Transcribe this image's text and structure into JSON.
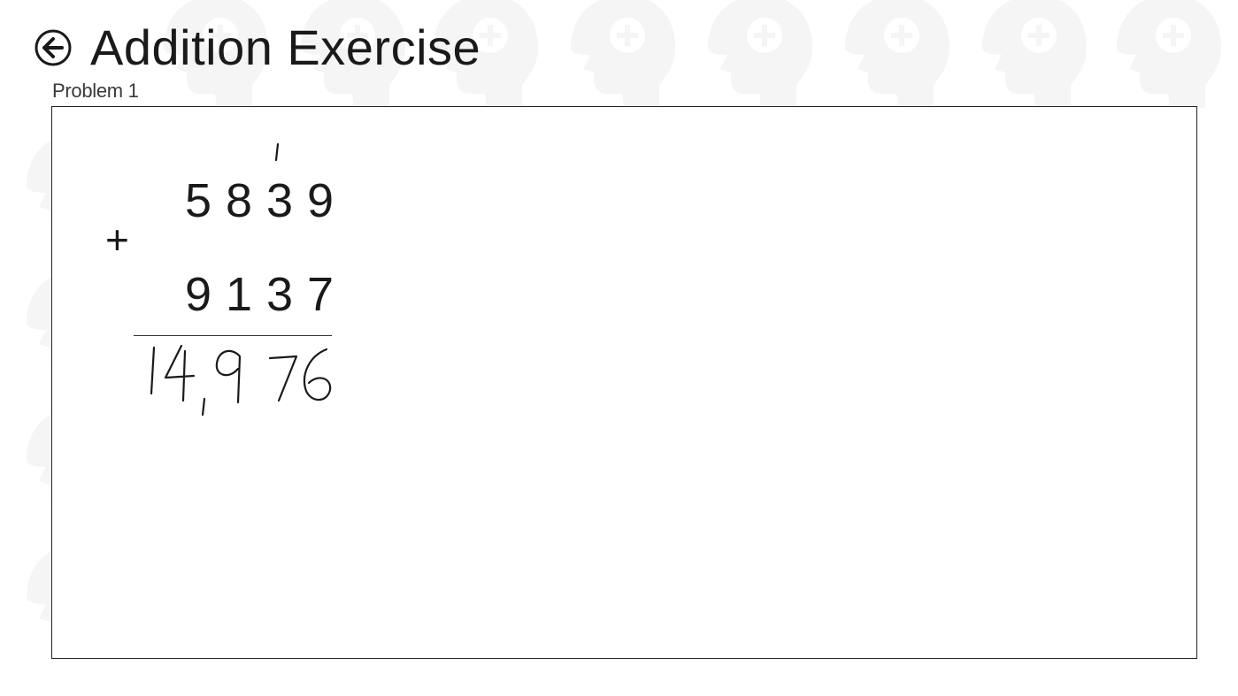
{
  "header": {
    "title": "Addition Exercise",
    "back_icon": "back-arrow-circle-icon"
  },
  "problem": {
    "label": "Problem 1",
    "addend_top": [
      "5",
      "8",
      "3",
      "9"
    ],
    "operator": "+",
    "addend_bottom": [
      "9",
      "1",
      "3",
      "7"
    ],
    "handwritten_carry": "1",
    "handwritten_answer": "14,976"
  },
  "colors": {
    "text": "#1a1a1a",
    "background": "#ffffff",
    "watermark": "#f4f4f4",
    "border": "#222222"
  }
}
